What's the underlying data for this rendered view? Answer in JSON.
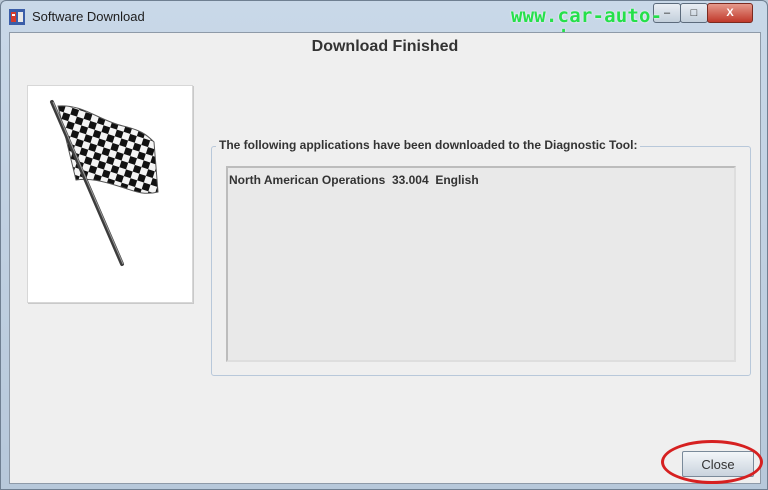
{
  "window": {
    "title": "Software Download",
    "icon": "app-icon",
    "controls": {
      "minimize": "–",
      "maximize": "□",
      "close": "X"
    }
  },
  "watermark": "www.car-auto-repair.com",
  "dialog": {
    "heading": "Download Finished",
    "image": "checkered-flag-icon",
    "group_label": "The following applications have been downloaded to the Diagnostic Tool:",
    "applications": [
      {
        "name": "North American Operations",
        "version": "33.004",
        "language": "English"
      }
    ],
    "close_label": "Close"
  },
  "colors": {
    "annotation": "#d62020",
    "watermark": "#25e04a"
  }
}
